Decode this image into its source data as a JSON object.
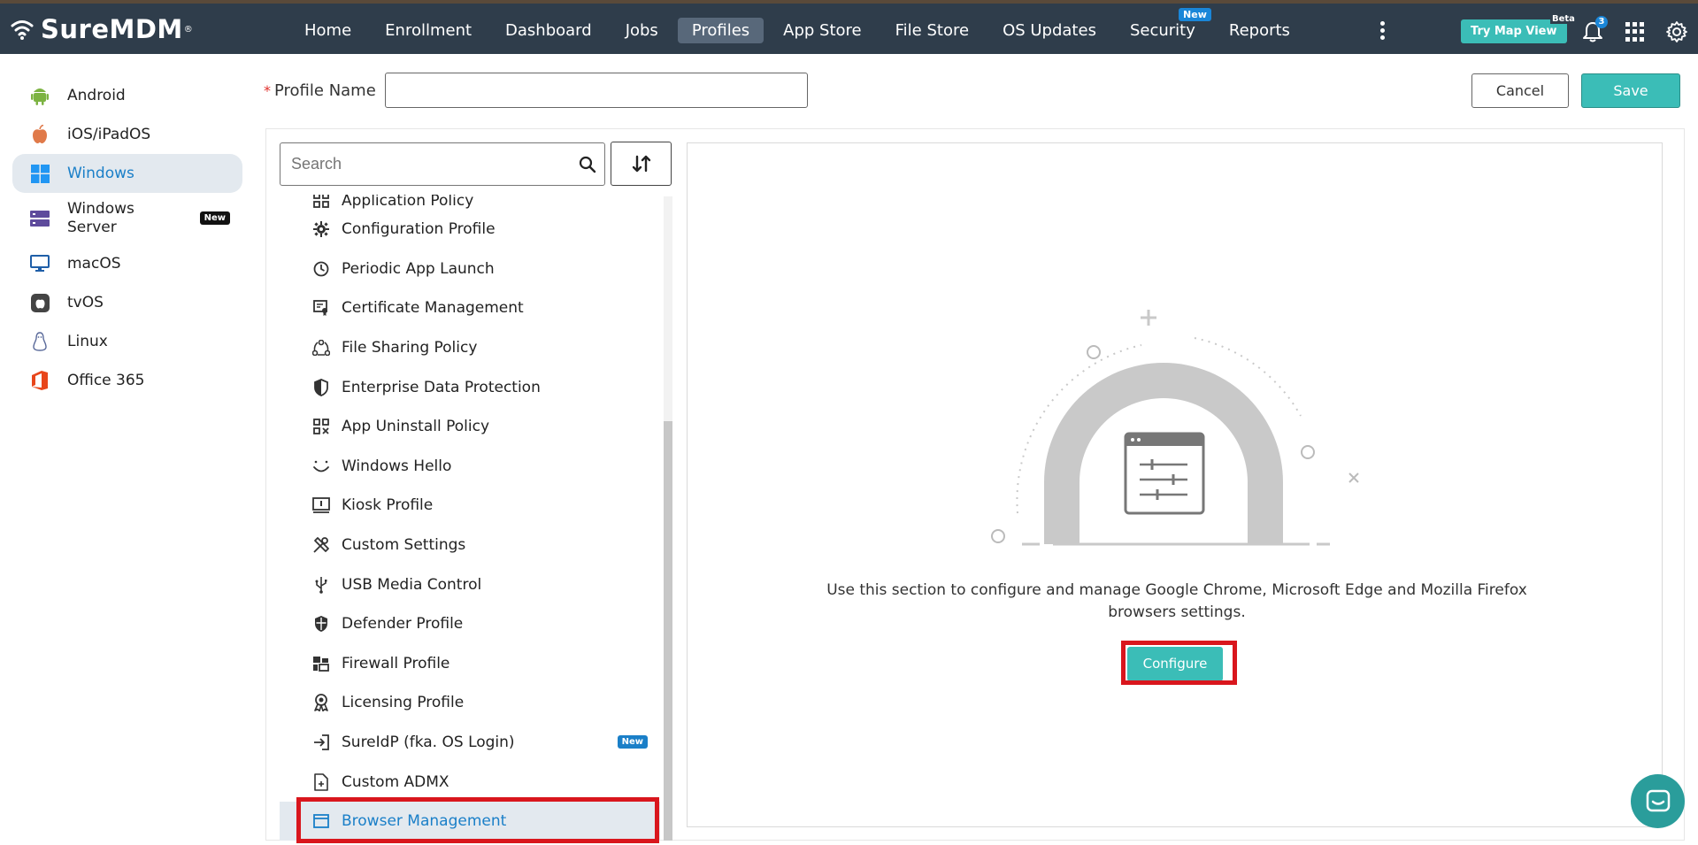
{
  "header": {
    "logo_text": "SureMDM",
    "logo_reg": "®",
    "nav": [
      {
        "label": "Home"
      },
      {
        "label": "Enrollment"
      },
      {
        "label": "Dashboard"
      },
      {
        "label": "Jobs"
      },
      {
        "label": "Profiles",
        "active": true
      },
      {
        "label": "App Store"
      },
      {
        "label": "File Store"
      },
      {
        "label": "OS Updates"
      },
      {
        "label": "Security",
        "badge": "New"
      },
      {
        "label": "Reports"
      }
    ],
    "try_map_view": "Try Map View",
    "beta": "Beta",
    "notification_count": "3",
    "accent_color": "#3bbdb7"
  },
  "sidebar": {
    "items": [
      {
        "label": "Android",
        "icon": "android-icon"
      },
      {
        "label": "iOS/iPadOS",
        "icon": "apple-icon"
      },
      {
        "label": "Windows",
        "icon": "windows-icon",
        "active": true
      },
      {
        "label": "Windows Server",
        "icon": "windows-server-icon",
        "badge": "New"
      },
      {
        "label": "macOS",
        "icon": "monitor-icon"
      },
      {
        "label": "tvOS",
        "icon": "appletv-icon"
      },
      {
        "label": "Linux",
        "icon": "linux-icon"
      },
      {
        "label": "Office 365",
        "icon": "office-icon"
      }
    ]
  },
  "profile": {
    "required_mark": "*",
    "name_label": "Profile Name",
    "name_value": "",
    "cancel_label": "Cancel",
    "save_label": "Save"
  },
  "search": {
    "placeholder": "Search"
  },
  "policy_list": {
    "items": [
      {
        "label": "Application Policy",
        "icon": "grid-icon",
        "partial": true
      },
      {
        "label": "Configuration Profile",
        "icon": "gear-icon"
      },
      {
        "label": "Periodic App Launch",
        "icon": "clock-icon"
      },
      {
        "label": "Certificate Management",
        "icon": "certificate-icon"
      },
      {
        "label": "File Sharing Policy",
        "icon": "share-icon"
      },
      {
        "label": "Enterprise Data Protection",
        "icon": "shield-icon"
      },
      {
        "label": "App Uninstall Policy",
        "icon": "app-uninstall-icon"
      },
      {
        "label": "Windows Hello",
        "icon": "smile-icon"
      },
      {
        "label": "Kiosk Profile",
        "icon": "kiosk-icon"
      },
      {
        "label": "Custom Settings",
        "icon": "tools-icon"
      },
      {
        "label": "USB Media Control",
        "icon": "usb-icon"
      },
      {
        "label": "Defender Profile",
        "icon": "defender-icon"
      },
      {
        "label": "Firewall Profile",
        "icon": "firewall-icon"
      },
      {
        "label": "Licensing Profile",
        "icon": "license-icon"
      },
      {
        "label": "SureIdP (fka. OS Login)",
        "icon": "login-icon",
        "badge": "New"
      },
      {
        "label": "Custom ADMX",
        "icon": "file-add-icon"
      },
      {
        "label": "Browser Management",
        "icon": "browser-icon",
        "active": true
      }
    ]
  },
  "content": {
    "description": "Use this section to configure and manage Google Chrome, Microsoft Edge and Mozilla Firefox browsers settings.",
    "configure_label": "Configure"
  }
}
